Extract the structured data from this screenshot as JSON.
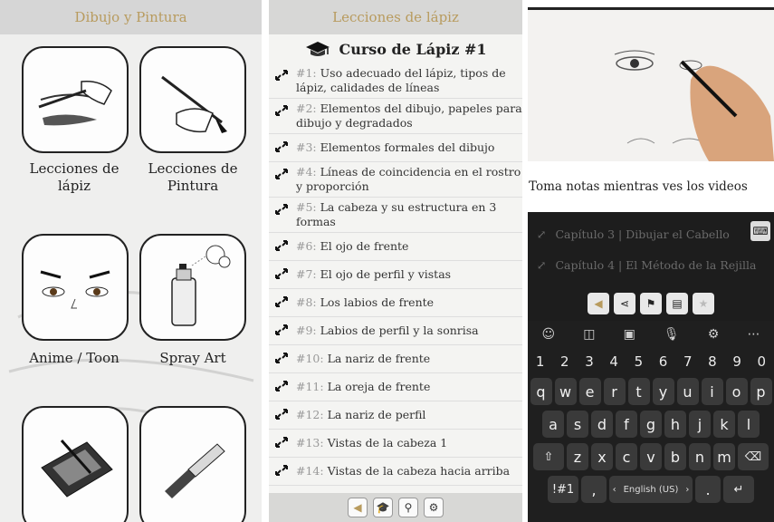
{
  "panel1": {
    "header": "Dibujo y Pintura",
    "tiles": [
      {
        "label": "Lecciones de lápiz"
      },
      {
        "label": "Lecciones de Pintura"
      },
      {
        "label": "Anime / Toon"
      },
      {
        "label": "Spray Art"
      }
    ]
  },
  "panel2": {
    "header": "Lecciones de lápiz",
    "course_title": "Curso de Lápiz #1",
    "lessons": [
      {
        "num": "#1:",
        "text": " Uso adecuado del lápiz, tipos de lápiz, calidades de líneas"
      },
      {
        "num": "#2:",
        "text": " Elementos del dibujo, papeles para dibujo y degradados"
      },
      {
        "num": "#3:",
        "text": " Elementos formales del dibujo"
      },
      {
        "num": "#4:",
        "text": " Líneas de coincidencia en el rostro y proporción"
      },
      {
        "num": "#5:",
        "text": " La cabeza y su estructura en 3 formas"
      },
      {
        "num": "#6:",
        "text": " El ojo de frente"
      },
      {
        "num": "#7:",
        "text": " El ojo de perfil y vistas"
      },
      {
        "num": "#8:",
        "text": " Los labios de frente"
      },
      {
        "num": "#9:",
        "text": " Labios de perfil y la sonrisa"
      },
      {
        "num": "#10:",
        "text": " La nariz de frente"
      },
      {
        "num": "#11:",
        "text": " La oreja de frente"
      },
      {
        "num": "#12:",
        "text": " La nariz de perfil"
      },
      {
        "num": "#13:",
        "text": " Vistas de la cabeza 1"
      },
      {
        "num": "#14:",
        "text": " Vistas de la cabeza hacia arriba"
      }
    ]
  },
  "panel3": {
    "notes": "Toma notas mientras ves los videos",
    "chapters": [
      "Capítulo 3 | Dibujar el Cabello",
      "Capítulo 4 | El Método de la Rejilla"
    ],
    "keyboard": {
      "numbers": [
        "1",
        "2",
        "3",
        "4",
        "5",
        "6",
        "7",
        "8",
        "9",
        "0"
      ],
      "row1": [
        "q",
        "w",
        "e",
        "r",
        "t",
        "y",
        "u",
        "i",
        "o",
        "p"
      ],
      "row2": [
        "a",
        "s",
        "d",
        "f",
        "g",
        "h",
        "j",
        "k",
        "l"
      ],
      "row3": [
        "z",
        "x",
        "c",
        "v",
        "b",
        "n",
        "m"
      ],
      "sym_key": "!#1",
      "comma_key": ",",
      "space_label": "English (US)",
      "period_key": "."
    }
  },
  "colors": {
    "header_text": "#b89b5e",
    "keyboard_bg": "#1f1f1f",
    "key_bg": "#3a3a3a"
  }
}
